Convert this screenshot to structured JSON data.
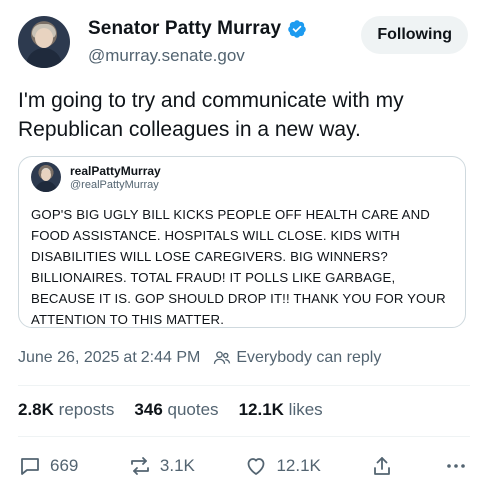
{
  "author": {
    "name": "Senator Patty Murray",
    "handle": "@murray.senate.gov",
    "follow_label": "Following"
  },
  "post": {
    "text": "I'm going to try and communicate with my Republican colleagues in a new way."
  },
  "quote": {
    "name": "realPattyMurray",
    "handle": "@realPattyMurray",
    "text": "GOP'S BIG UGLY BILL KICKS PEOPLE OFF HEALTH CARE AND FOOD ASSISTANCE. HOSPITALS WILL CLOSE. KIDS WITH DISABILITIES WILL LOSE CAREGIVERS. BIG WINNERS? BILLIONAIRES. TOTAL FRAUD! IT POLLS LIKE GARBAGE, BECAUSE IT IS. GOP SHOULD DROP IT!! THANK YOU FOR YOUR ATTENTION TO THIS MATTER."
  },
  "meta": {
    "date": "June 26, 2025",
    "at": "at",
    "time": "2:44 PM",
    "reply_setting": "Everybody can reply"
  },
  "stats": {
    "reposts_count": "2.8K",
    "reposts_label": "reposts",
    "quotes_count": "346",
    "quotes_label": "quotes",
    "likes_count": "12.1K",
    "likes_label": "likes"
  },
  "actions": {
    "replies": "669",
    "reposts": "3.1K",
    "likes": "12.1K"
  },
  "colors": {
    "verified": "#1d9bf0",
    "secondary_text": "#536471",
    "follow_bg": "#eff3f4"
  },
  "icons": [
    "verified-badge-icon",
    "people-icon",
    "reply-icon",
    "repost-icon",
    "like-icon",
    "share-icon",
    "more-icon"
  ]
}
